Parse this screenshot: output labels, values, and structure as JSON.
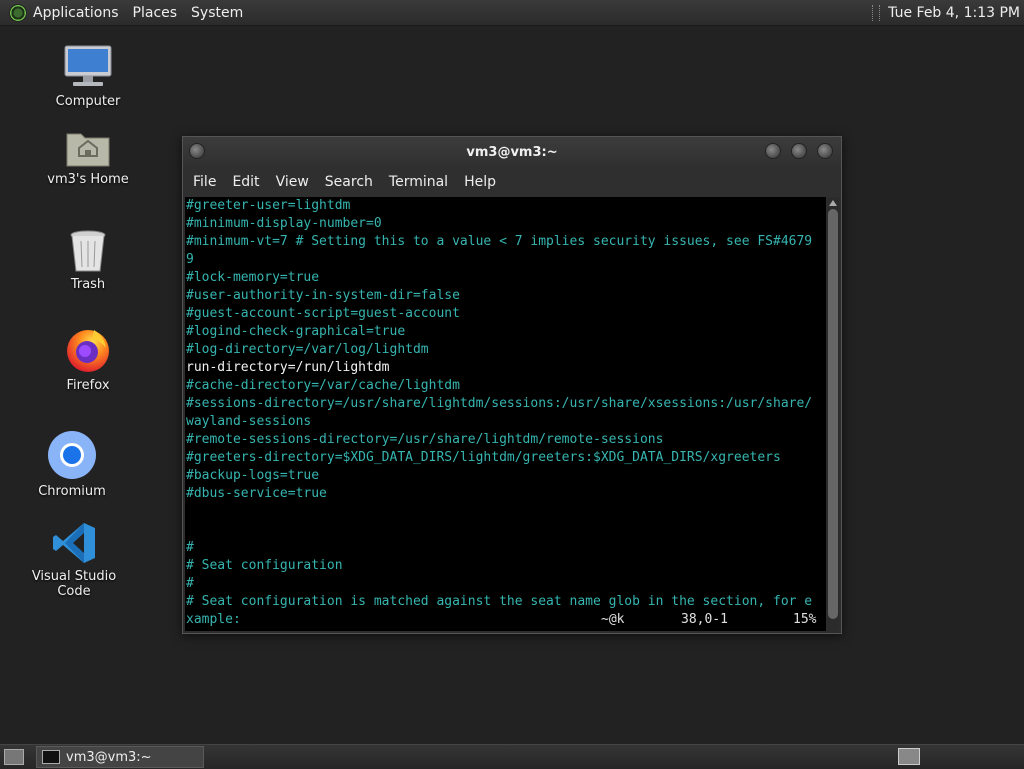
{
  "top_panel": {
    "menus": [
      "Applications",
      "Places",
      "System"
    ],
    "clock": "Tue Feb  4,  1:13 PM"
  },
  "desktop": {
    "icons": [
      {
        "label": "Computer",
        "icon": "computer-icon"
      },
      {
        "label": "vm3's Home",
        "icon": "home-folder-icon"
      },
      {
        "label": "Trash",
        "icon": "trash-icon"
      },
      {
        "label": "Firefox",
        "icon": "firefox-icon"
      },
      {
        "label": "Chromium",
        "icon": "chromium-icon"
      },
      {
        "label": "Visual Studio Code",
        "icon": "vscode-icon"
      }
    ]
  },
  "terminal": {
    "title": "vm3@vm3:~",
    "menu": [
      "File",
      "Edit",
      "View",
      "Search",
      "Terminal",
      "Help"
    ],
    "lines": [
      {
        "text": "#greeter-user=lightdm",
        "color": "cyan"
      },
      {
        "text": "#minimum-display-number=0",
        "color": "cyan"
      },
      {
        "text": "#minimum-vt=7 # Setting this to a value < 7 implies security issues, see FS#4679",
        "color": "cyan"
      },
      {
        "text": "9",
        "color": "cyan"
      },
      {
        "text": "#lock-memory=true",
        "color": "cyan"
      },
      {
        "text": "#user-authority-in-system-dir=false",
        "color": "cyan"
      },
      {
        "text": "#guest-account-script=guest-account",
        "color": "cyan"
      },
      {
        "text": "#logind-check-graphical=true",
        "color": "cyan"
      },
      {
        "text": "#log-directory=/var/log/lightdm",
        "color": "cyan"
      },
      {
        "text": "run-directory=/run/lightdm",
        "color": "white"
      },
      {
        "text": "#cache-directory=/var/cache/lightdm",
        "color": "cyan"
      },
      {
        "text": "#sessions-directory=/usr/share/lightdm/sessions:/usr/share/xsessions:/usr/share/",
        "color": "cyan"
      },
      {
        "text": "wayland-sessions",
        "color": "cyan"
      },
      {
        "text": "#remote-sessions-directory=/usr/share/lightdm/remote-sessions",
        "color": "cyan"
      },
      {
        "text": "#greeters-directory=$XDG_DATA_DIRS/lightdm/greeters:$XDG_DATA_DIRS/xgreeters",
        "color": "cyan"
      },
      {
        "text": "#backup-logs=true",
        "color": "cyan"
      },
      {
        "text": "#dbus-service=true",
        "color": "cyan"
      },
      {
        "text": "",
        "color": "cyan"
      },
      {
        "text": "",
        "color": "cyan"
      },
      {
        "text": "#",
        "color": "cyan"
      },
      {
        "text": "# Seat configuration",
        "color": "cyan"
      },
      {
        "text": "#",
        "color": "cyan"
      },
      {
        "text": "# Seat configuration is matched against the seat name glob in the section, for e",
        "color": "cyan"
      },
      {
        "text": "xample:",
        "color": "cyan"
      }
    ],
    "status": {
      "keys": "~@k",
      "position": "38,0-1",
      "percent": "15%"
    }
  },
  "taskbar": {
    "task_label": "vm3@vm3:~"
  }
}
